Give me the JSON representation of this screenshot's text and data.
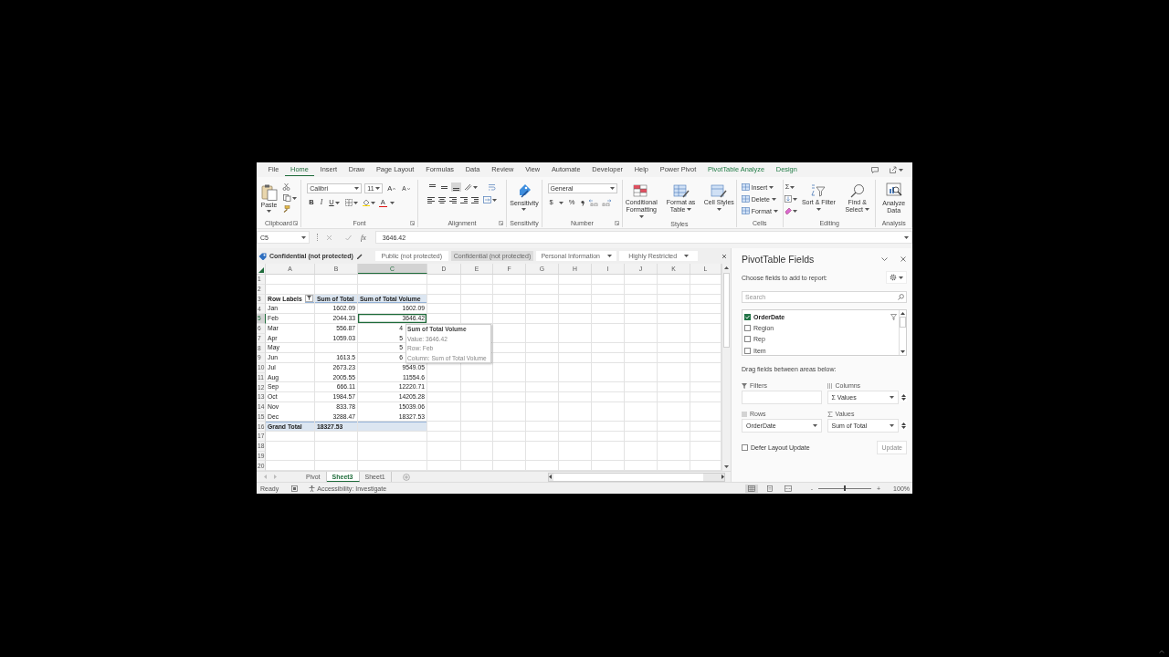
{
  "menu_tabs": [
    {
      "label": "File",
      "selected": false,
      "kind": "normal"
    },
    {
      "label": "Home",
      "selected": true,
      "kind": "normal"
    },
    {
      "label": "Insert",
      "selected": false,
      "kind": "normal"
    },
    {
      "label": "Draw",
      "selected": false,
      "kind": "normal"
    },
    {
      "label": "Page Layout",
      "selected": false,
      "kind": "normal"
    },
    {
      "label": "Formulas",
      "selected": false,
      "kind": "normal"
    },
    {
      "label": "Data",
      "selected": false,
      "kind": "normal"
    },
    {
      "label": "Review",
      "selected": false,
      "kind": "normal"
    },
    {
      "label": "View",
      "selected": false,
      "kind": "normal"
    },
    {
      "label": "Automate",
      "selected": false,
      "kind": "normal"
    },
    {
      "label": "Developer",
      "selected": false,
      "kind": "normal"
    },
    {
      "label": "Help",
      "selected": false,
      "kind": "normal"
    },
    {
      "label": "Power Pivot",
      "selected": false,
      "kind": "normal"
    },
    {
      "label": "PivotTable Analyze",
      "selected": false,
      "kind": "contextual"
    },
    {
      "label": "Design",
      "selected": false,
      "kind": "contextual"
    }
  ],
  "ribbon": {
    "groups": [
      {
        "kind": "clipboard",
        "label": "Clipboard",
        "launcher": true,
        "paste": "Paste"
      },
      {
        "kind": "font",
        "label": "Font",
        "launcher": true,
        "font_name": "Calibri",
        "font_size": "11",
        "grow": "A",
        "shrink": "A",
        "bold": "B",
        "italic": "I",
        "underline": "U",
        "font_color": "A"
      },
      {
        "kind": "alignment",
        "label": "Alignment",
        "launcher": true,
        "vertical_align": [
          {
            "selected": false
          },
          {
            "selected": false
          },
          {
            "selected": true
          }
        ]
      },
      {
        "kind": "sensitivity",
        "label": "Sensitivity",
        "launcher": false,
        "button": "Sensitivity"
      },
      {
        "kind": "number",
        "label": "Number",
        "launcher": true,
        "format": "General",
        "currency": "$",
        "percent": "%"
      },
      {
        "kind": "styles",
        "label": "Styles",
        "launcher": false,
        "buttons": [
          "Conditional Formatting",
          "Format as Table",
          "Cell Styles"
        ]
      },
      {
        "kind": "cells",
        "label": "Cells",
        "launcher": false,
        "buttons": [
          "Insert",
          "Delete",
          "Format"
        ]
      },
      {
        "kind": "editing",
        "label": "Editing",
        "launcher": false,
        "autosum": "Σ",
        "buttons": [
          "Sort & Filter",
          "Find & Select"
        ]
      },
      {
        "kind": "analysis",
        "label": "Analysis",
        "launcher": false,
        "button": "Analyze Data"
      }
    ]
  },
  "formula_bar": {
    "name_box": "C5",
    "function_label": "fx",
    "value": "3646.42"
  },
  "sensitivity_bar": {
    "current": "Confidential (not protected)",
    "labels": [
      {
        "label": "Public (not protected)",
        "selected": false,
        "dropdown": false
      },
      {
        "label": "Confidential (not protected)",
        "selected": true,
        "dropdown": false
      },
      {
        "label": "Personal Information",
        "selected": false,
        "dropdown": true
      },
      {
        "label": "Highly Restricted",
        "selected": false,
        "dropdown": true
      }
    ]
  },
  "sheet": {
    "columns": [
      {
        "label": "A",
        "selected": false
      },
      {
        "label": "B",
        "selected": false
      },
      {
        "label": "C",
        "selected": true
      },
      {
        "label": "D",
        "selected": false
      },
      {
        "label": "E",
        "selected": false
      },
      {
        "label": "F",
        "selected": false
      },
      {
        "label": "G",
        "selected": false
      },
      {
        "label": "H",
        "selected": false
      },
      {
        "label": "I",
        "selected": false
      },
      {
        "label": "J",
        "selected": false
      },
      {
        "label": "K",
        "selected": false
      },
      {
        "label": "L",
        "selected": false
      }
    ],
    "rows": [
      {
        "number": "1",
        "selected": false,
        "kind": "blank"
      },
      {
        "number": "2",
        "selected": false,
        "kind": "blank"
      },
      {
        "number": "3",
        "selected": false,
        "kind": "header",
        "row_label": "Row Labels",
        "sum_of_total": "Sum of Total",
        "sum_of_total_volume": "Sum of Total Volume",
        "filtered": true
      },
      {
        "number": "4",
        "selected": false,
        "kind": "data",
        "row_label": "Jan",
        "sum_of_total": "1602.09",
        "sum_of_total_volume": "1602.09"
      },
      {
        "number": "5",
        "selected": true,
        "kind": "data",
        "row_label": "Feb",
        "sum_of_total": "2044.33",
        "sum_of_total_volume": "3646.42"
      },
      {
        "number": "6",
        "selected": false,
        "kind": "covered",
        "row_label": "Mar",
        "sum_of_total": "556.87",
        "sum_of_total_volume": "4"
      },
      {
        "number": "7",
        "selected": false,
        "kind": "covered",
        "row_label": "Apr",
        "sum_of_total": "1059.03",
        "sum_of_total_volume": "5"
      },
      {
        "number": "8",
        "selected": false,
        "kind": "covered",
        "row_label": "May",
        "sum_of_total_volume": "5"
      },
      {
        "number": "9",
        "selected": false,
        "kind": "covered",
        "row_label": "Jun",
        "sum_of_total": "1613.5",
        "sum_of_total_volume": "6"
      },
      {
        "number": "10",
        "selected": false,
        "kind": "data",
        "row_label": "Jul",
        "sum_of_total": "2673.23",
        "sum_of_total_volume": "9549.05"
      },
      {
        "number": "11",
        "selected": false,
        "kind": "data",
        "row_label": "Aug",
        "sum_of_total": "2005.55",
        "sum_of_total_volume": "11554.6"
      },
      {
        "number": "12",
        "selected": false,
        "kind": "data",
        "row_label": "Sep",
        "sum_of_total": "666.11",
        "sum_of_total_volume": "12220.71"
      },
      {
        "number": "13",
        "selected": false,
        "kind": "data",
        "row_label": "Oct",
        "sum_of_total": "1984.57",
        "sum_of_total_volume": "14205.28"
      },
      {
        "number": "14",
        "selected": false,
        "kind": "data",
        "row_label": "Nov",
        "sum_of_total": "833.78",
        "sum_of_total_volume": "15039.06"
      },
      {
        "number": "15",
        "selected": false,
        "kind": "data",
        "row_label": "Dec",
        "sum_of_total": "3288.47",
        "sum_of_total_volume": "18327.53"
      },
      {
        "number": "16",
        "selected": false,
        "kind": "total",
        "row_label": "Grand Total",
        "sum_of_total": "18327.53"
      },
      {
        "number": "17",
        "selected": false,
        "kind": "blank"
      },
      {
        "number": "18",
        "selected": false,
        "kind": "blank"
      },
      {
        "number": "19",
        "selected": false,
        "kind": "blank"
      },
      {
        "number": "20",
        "selected": false,
        "kind": "blank"
      }
    ],
    "tooltip": {
      "title": "Sum of Total Volume",
      "lines": [
        "Value: 3646.42",
        "Row: Feb",
        "Column: Sum of Total Volume"
      ]
    }
  },
  "sheet_tabs": [
    {
      "label": "Pivot",
      "selected": false
    },
    {
      "label": "Sheet3",
      "selected": true
    },
    {
      "label": "Sheet1",
      "selected": false
    }
  ],
  "pivot_pane": {
    "title": "PivotTable Fields",
    "subtitle": "Choose fields to add to report:",
    "search": {
      "placeholder": "Search"
    },
    "fields": [
      {
        "name": "OrderDate",
        "checked": true,
        "filtered": true
      },
      {
        "name": "Region",
        "checked": false,
        "filtered": false
      },
      {
        "name": "Rep",
        "checked": false,
        "filtered": false
      },
      {
        "name": "Item",
        "checked": false,
        "filtered": false
      }
    ],
    "drag_hint": "Drag fields between areas below:",
    "areas": [
      {
        "kind": "filters",
        "name": "Filters",
        "scrollable": false
      },
      {
        "kind": "columns",
        "name": "Columns",
        "field": "Σ Values",
        "scrollable": true
      },
      {
        "kind": "rows",
        "name": "Rows",
        "field": "OrderDate",
        "scrollable": false
      },
      {
        "kind": "values",
        "name": "Values",
        "field": "Sum of Total",
        "scrollable": true
      }
    ],
    "defer": {
      "label": "Defer Layout Update",
      "checked": false
    },
    "update_button": {
      "label": "Update",
      "disabled": true
    }
  },
  "status_bar": {
    "mode": "Ready",
    "accessibility": "Accessibility: Investigate",
    "views": [
      {
        "selected": true
      },
      {
        "selected": false
      },
      {
        "selected": false
      }
    ],
    "zoom_out": "-",
    "zoom_in": "+",
    "zoom_slider": {
      "level": 0.5
    },
    "zoom": "100%"
  }
}
